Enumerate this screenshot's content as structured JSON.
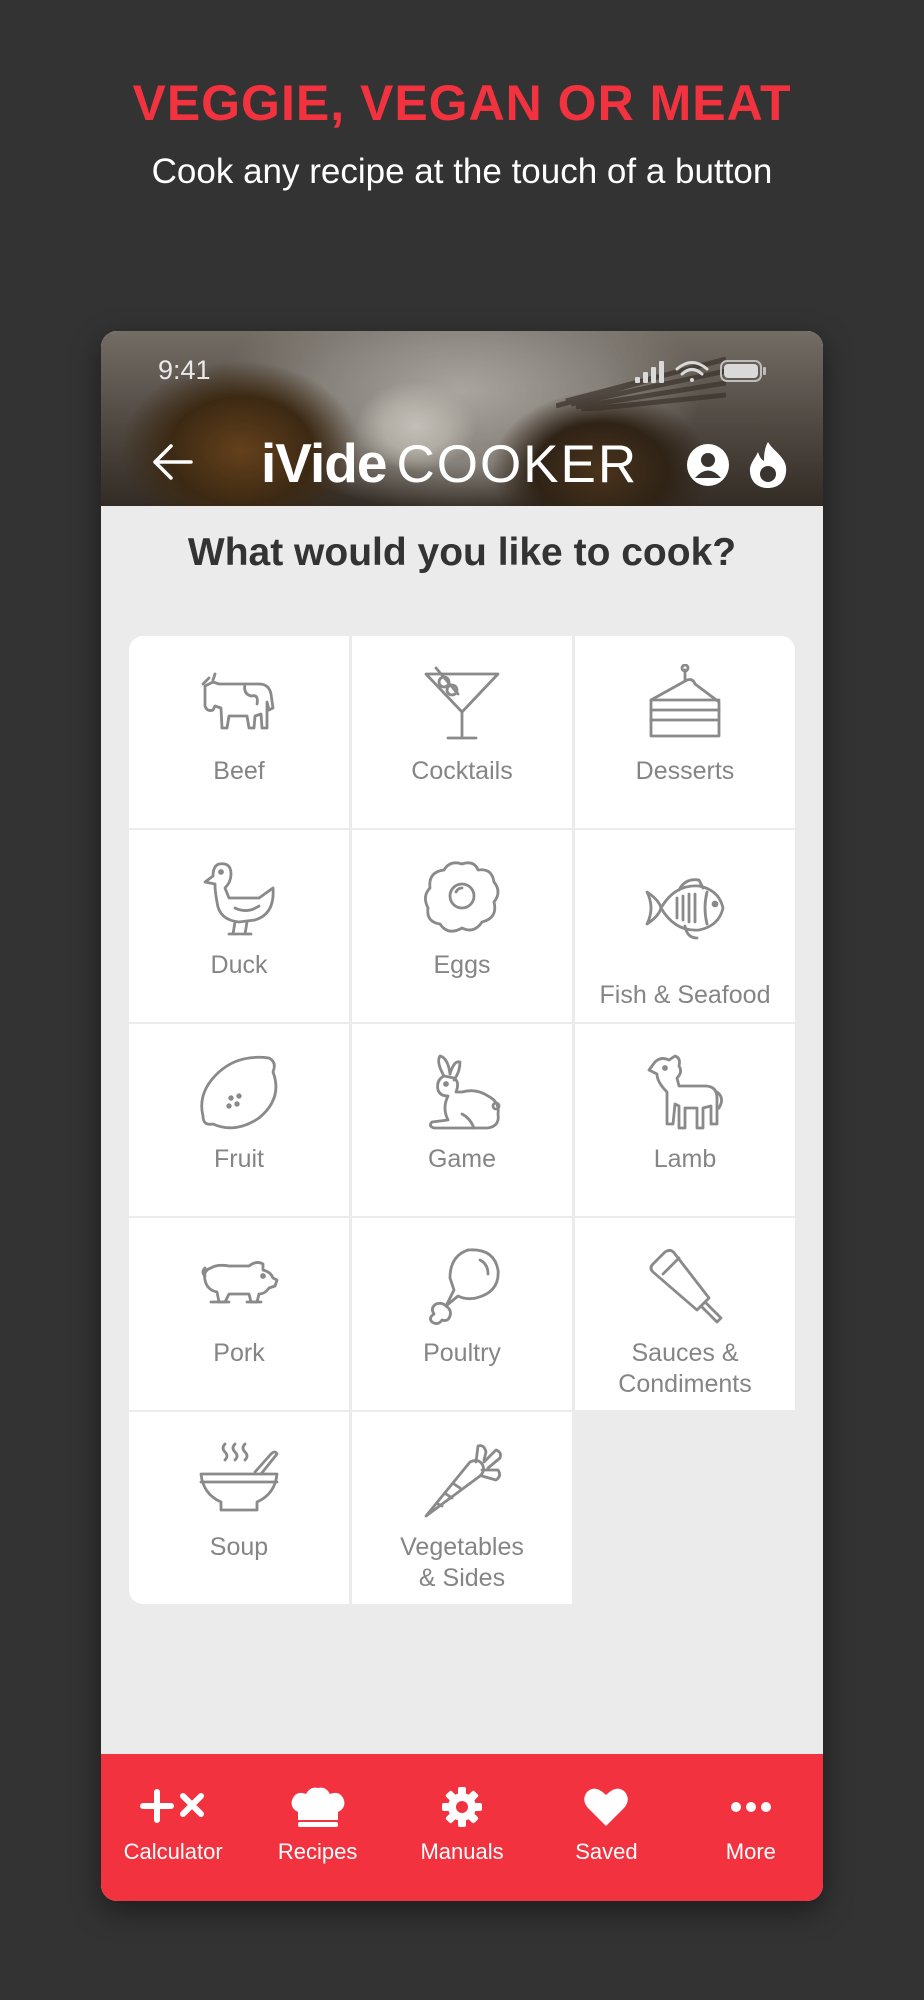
{
  "promo": {
    "headline": "VEGGIE, VEGAN OR MEAT",
    "subline": "Cook any recipe at the touch of a button"
  },
  "status_bar": {
    "time": "9:41",
    "icons": [
      "signal-icon",
      "wifi-icon",
      "battery-icon"
    ]
  },
  "app_header": {
    "brand_bold": "iVide",
    "brand_light": "COOKER",
    "icons": [
      "back-arrow-icon",
      "profile-icon",
      "flame-icon"
    ]
  },
  "main": {
    "question": "What would you like to cook?",
    "categories": [
      {
        "label": "Beef",
        "icon": "cow-icon"
      },
      {
        "label": "Cocktails",
        "icon": "cocktail-icon"
      },
      {
        "label": "Desserts",
        "icon": "cake-slice-icon"
      },
      {
        "label": "Duck",
        "icon": "duck-icon"
      },
      {
        "label": "Eggs",
        "icon": "fried-egg-icon"
      },
      {
        "label": "Fish & Seafood",
        "icon": "fish-icon"
      },
      {
        "label": "Fruit",
        "icon": "lemon-icon"
      },
      {
        "label": "Game",
        "icon": "rabbit-icon"
      },
      {
        "label": "Lamb",
        "icon": "lamb-icon"
      },
      {
        "label": "Pork",
        "icon": "pig-icon"
      },
      {
        "label": "Poultry",
        "icon": "drumstick-icon"
      },
      {
        "label": "Sauces & Condiments",
        "icon": "sauce-bottle-icon"
      },
      {
        "label": "Soup",
        "icon": "soup-bowl-icon"
      },
      {
        "label": "Vegetables & Sides",
        "icon": "carrot-icon"
      }
    ]
  },
  "tab_bar": {
    "items": [
      {
        "label": "Calculator",
        "icon": "plus-times-icon"
      },
      {
        "label": "Recipes",
        "icon": "chef-hat-icon"
      },
      {
        "label": "Manuals",
        "icon": "gear-icon"
      },
      {
        "label": "Saved",
        "icon": "heart-icon"
      },
      {
        "label": "More",
        "icon": "more-dots-icon"
      }
    ]
  },
  "colors": {
    "accent": "#f2323f",
    "page_background": "#333333",
    "app_background": "#ebebeb",
    "tile_background": "#ffffff",
    "label_gray": "#858585"
  }
}
